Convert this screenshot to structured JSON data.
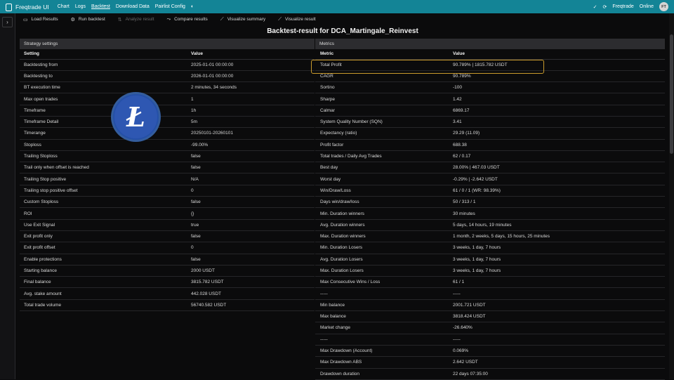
{
  "topbar": {
    "brand": "Freqtrade UI",
    "nav": [
      "Chart",
      "Logs",
      "Backtest",
      "Download Data",
      "Pairlist Config"
    ],
    "active_nav": "Backtest",
    "status": "Freqtrade",
    "status_state": "Online",
    "avatar": "FT"
  },
  "tabs": [
    {
      "label": "Load Results",
      "icon": "folder-icon"
    },
    {
      "label": "Run backtest",
      "icon": "run-icon"
    },
    {
      "label": "Analyze result",
      "icon": "analyze-icon"
    },
    {
      "label": "Compare results",
      "icon": "compare-icon"
    },
    {
      "label": "Visualize summary",
      "icon": "summary-icon"
    },
    {
      "label": "Visualize result",
      "icon": "chart-icon"
    }
  ],
  "title": "Backtest-result for DCA_Martingale_Reinvest",
  "strategy": {
    "header": "Strategy settings",
    "col_setting": "Setting",
    "col_value": "Value",
    "rows": [
      [
        "Backtesting from",
        "2025-01-01 00:00:00"
      ],
      [
        "Backtesting to",
        "2026-01-01 00:00:00"
      ],
      [
        "BT execution time",
        "2 minutes, 34 seconds"
      ],
      [
        "Max open trades",
        "1"
      ],
      [
        "Timeframe",
        "1h"
      ],
      [
        "Timeframe Detail",
        "5m"
      ],
      [
        "Timerange",
        "20250101-20260101"
      ],
      [
        "Stoploss",
        "-99.00%"
      ],
      [
        "Trailing Stoploss",
        "false"
      ],
      [
        "Trail only when offset is reached",
        "false"
      ],
      [
        "Trailing Stop positive",
        "N/A"
      ],
      [
        "Trailing stop positive offset",
        "0"
      ],
      [
        "Custom Stoploss",
        "false"
      ],
      [
        "ROI",
        "{}"
      ],
      [
        "Use Exit Signal",
        "true"
      ],
      [
        "Exit profit only",
        "false"
      ],
      [
        "Exit profit offset",
        "0"
      ],
      [
        "Enable protections",
        "false"
      ],
      [
        "Starting balance",
        "2000 USDT"
      ],
      [
        "Final balance",
        "3815.782 USDT"
      ],
      [
        "Avg. stake amount",
        "442.028 USDT"
      ],
      [
        "Total trade volume",
        "56740.582 USDT"
      ]
    ]
  },
  "metrics": {
    "header": "Metrics",
    "col_metric": "Metric",
    "col_value": "Value",
    "rows": [
      [
        "Total Profit",
        "90.789% | 1815.782 USDT"
      ],
      [
        "CAGR",
        "90.789%"
      ],
      [
        "Sortino",
        "-100"
      ],
      [
        "Sharpe",
        "1.42"
      ],
      [
        "Calmar",
        "6869.17"
      ],
      [
        "System Quality Number (SQN)",
        "3.41"
      ],
      [
        "Expectancy (ratio)",
        "29.29 (11.09)"
      ],
      [
        "Profit factor",
        "688.38"
      ],
      [
        "Total trades / Daily Avg Trades",
        "62 / 0.17"
      ],
      [
        "Best day",
        "28.00% | 467.03 USDT"
      ],
      [
        "Worst day",
        "-0.29% | -2.642 USDT"
      ],
      [
        "Win/Draw/Loss",
        "61 / 0 / 1 (WR: 98.39%)"
      ],
      [
        "Days win/draw/loss",
        "50 / 313 / 1"
      ],
      [
        "Min. Duration winners",
        "30 minutes"
      ],
      [
        "Avg. Duration winners",
        "5 days, 14 hours, 19 minutes"
      ],
      [
        "Max. Duration winners",
        "1 month, 2 weeks, 5 days, 15 hours, 25 minutes"
      ],
      [
        "Min. Duration Losers",
        "3 weeks, 1 day, 7 hours"
      ],
      [
        "Avg. Duration Losers",
        "3 weeks, 1 day, 7 hours"
      ],
      [
        "Max. Duration Losers",
        "3 weeks, 1 day, 7 hours"
      ],
      [
        "Max Consecutive Wins / Loss",
        "61 / 1"
      ],
      [
        "-----",
        "-----"
      ],
      [
        "Min balance",
        "2001.721 USDT"
      ],
      [
        "Max balance",
        "3818.424 USDT"
      ],
      [
        "Market change",
        "-26.640%"
      ],
      [
        "-----",
        "-----"
      ],
      [
        "Max Drawdown (Account)",
        "0.069%"
      ],
      [
        "Max Drawdown ABS",
        "2.642 USDT"
      ],
      [
        "Drawdown duration",
        "22 days 07:35:00"
      ]
    ]
  },
  "colors": {
    "topbar": "#138496",
    "highlight": "#c99a2c",
    "coin": "#345d9d"
  }
}
